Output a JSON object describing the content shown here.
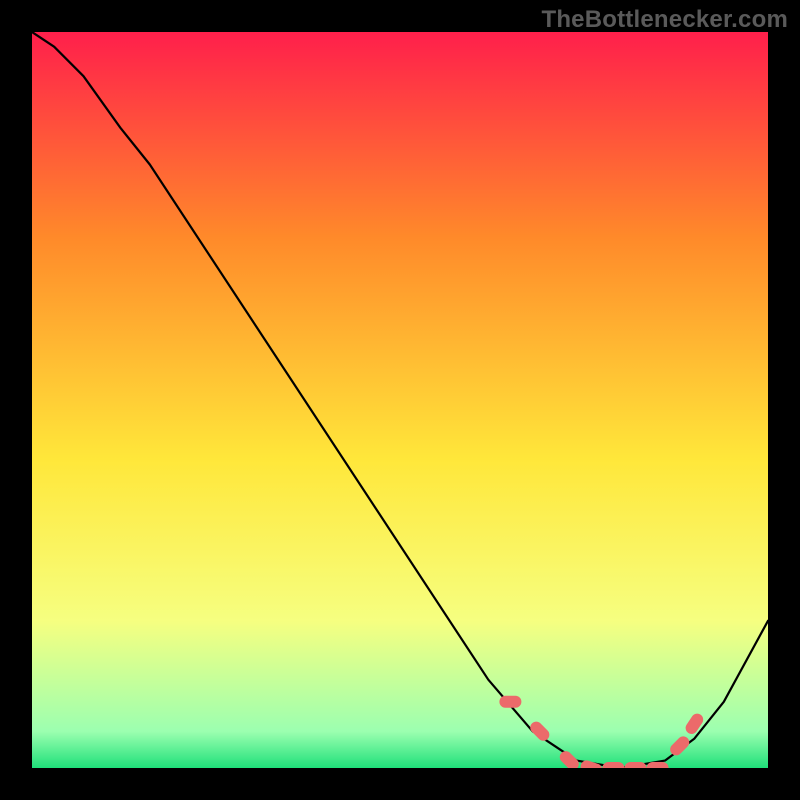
{
  "watermark_text": "TheBottlenecker.com",
  "gradient_colors": {
    "top": "#ff1f4b",
    "upper_mid": "#ff8a2a",
    "mid": "#ffe73a",
    "lower_mid": "#f6ff80",
    "near_bottom": "#9cffb0",
    "bottom": "#1fe07a"
  },
  "marker_color": "#ec6a6a",
  "chart_data": {
    "type": "line",
    "title": "",
    "xlabel": "",
    "ylabel": "",
    "xlim": [
      0,
      100
    ],
    "ylim": [
      0,
      100
    ],
    "series": [
      {
        "name": "curve",
        "x": [
          0,
          3,
          7,
          12,
          16,
          62,
          68,
          74,
          80,
          86,
          90,
          94,
          100
        ],
        "y": [
          100,
          98,
          94,
          87,
          82,
          12,
          5,
          1,
          0,
          1,
          4,
          9,
          20
        ]
      }
    ],
    "markers": {
      "name": "highlighted-points",
      "x": [
        65,
        69,
        73,
        76,
        79,
        82,
        85,
        88,
        90
      ],
      "y": [
        9,
        5,
        1,
        0,
        0,
        0,
        0,
        3,
        6
      ]
    },
    "band_at": 80
  }
}
